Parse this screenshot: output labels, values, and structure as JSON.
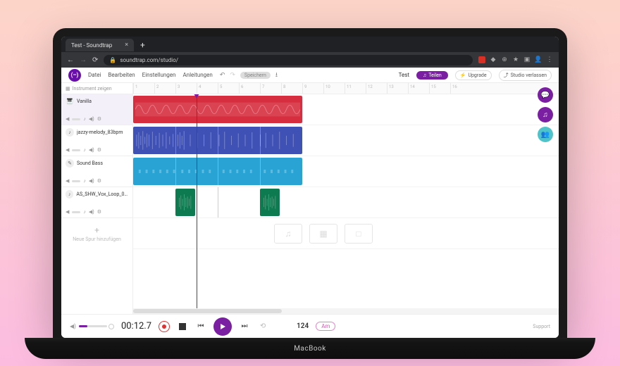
{
  "browser": {
    "tab_title": "Test - Soundtrap",
    "url": "soundtrap.com/studio/"
  },
  "topbar": {
    "menus": [
      "Datei",
      "Bearbeiten",
      "Einstellungen",
      "Anleitungen"
    ],
    "save_pill": "Speichern",
    "project_name": "Test",
    "share_label": "Teilen",
    "upgrade_label": "Upgrade",
    "exit_label": "Studio verlassen"
  },
  "trackpanel": {
    "header": "Instrument zeigen",
    "tracks": [
      {
        "name": "Vanilla",
        "icon": "🎹"
      },
      {
        "name": "jazzy-melody_83bpm",
        "icon": "♪"
      },
      {
        "name": "Sound Bass",
        "icon": "✎"
      },
      {
        "name": "AS_SHW_Vox_Loop_02...",
        "icon": "♪"
      }
    ],
    "add_label": "Neue Spur hinzufügen"
  },
  "ruler_ticks": [
    "1",
    "2",
    "3",
    "4",
    "5",
    "6",
    "7",
    "8",
    "9",
    "10",
    "11",
    "12",
    "13",
    "14",
    "15",
    "16"
  ],
  "transport": {
    "time": "00:12.7",
    "bpm": "124",
    "key": "Am"
  },
  "footer": {
    "support": "Support"
  }
}
